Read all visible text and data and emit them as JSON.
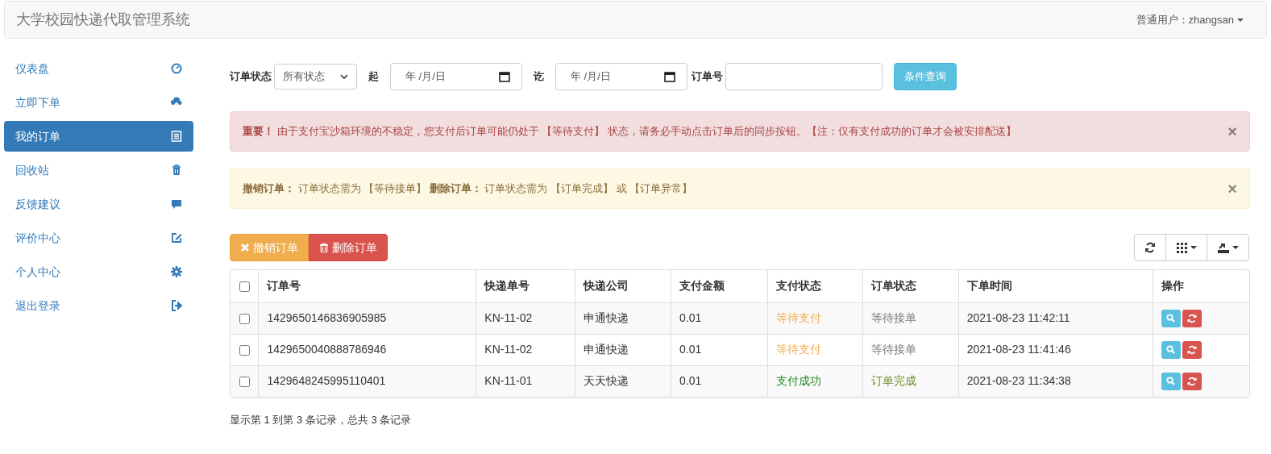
{
  "navbar": {
    "title": "大学校园快递代取管理系统",
    "user_menu": "普通用户：zhangsan"
  },
  "sidebar": {
    "items": [
      {
        "label": "仪表盘",
        "kind": "dashboard",
        "selected": false
      },
      {
        "label": "立即下单",
        "kind": "upload",
        "selected": false
      },
      {
        "label": "我的订单",
        "kind": "orders",
        "selected": true
      },
      {
        "label": "回收站",
        "kind": "trash",
        "selected": false
      },
      {
        "label": "反馈建议",
        "kind": "feedback",
        "selected": false
      },
      {
        "label": "评价中心",
        "kind": "review",
        "selected": false
      },
      {
        "label": "个人中心",
        "kind": "profile",
        "selected": false
      },
      {
        "label": "退出登录",
        "kind": "logout",
        "selected": false
      }
    ]
  },
  "filters": {
    "status_label": "订单状态",
    "status_value": "所有状态",
    "from_label": "起",
    "from_date": {
      "placeholder": "年 /月/日"
    },
    "to_label": "讫",
    "to_date": {
      "placeholder": "年 /月/日"
    },
    "order_no_label": "订单号",
    "search_button": "条件查询"
  },
  "alerts": [
    {
      "kind": "danger",
      "text": "**重要！** 由于支付宝沙箱环境的不稳定，您支付后订单可能仍处于 【等待支付】 状态，请务必手动点击订单后的同步按钮。【注：仅有支付成功的订单才会被安排配送】",
      "close": "×"
    },
    {
      "kind": "warning",
      "text": "**撤销订单：** 订单状态需为 【等待接单】 **删除订单：** 订单状态需为 【订单完成】 或 【订单异常】",
      "close": "×"
    }
  ],
  "toolbar": {
    "buttons": [
      {
        "label": "撤销订单",
        "kind": "cancel"
      },
      {
        "label": "删除订单",
        "kind": "delete"
      }
    ]
  },
  "table": {
    "columns": [
      "订单号",
      "快递单号",
      "快递公司",
      "支付金额",
      "支付状态",
      "订单状态",
      "下单时间",
      "操作"
    ],
    "rows": [
      {
        "checked": false,
        "order_no": "1429650146836905985",
        "tracking_no": "KN-11-02",
        "company": "申通快递",
        "amount": "0.01",
        "pay_status": {
          "text": "等待支付",
          "color": "#f0ad4e"
        },
        "order_status": {
          "text": "等待接单",
          "color": "#777777"
        },
        "time": "2021-08-23 11:42:11"
      },
      {
        "checked": false,
        "order_no": "1429650040888786946",
        "tracking_no": "KN-11-02",
        "company": "申通快递",
        "amount": "0.01",
        "pay_status": {
          "text": "等待支付",
          "color": "#f0ad4e"
        },
        "order_status": {
          "text": "等待接单",
          "color": "#777777"
        },
        "time": "2021-08-23 11:41:46"
      },
      {
        "checked": false,
        "order_no": "1429648245995110401",
        "tracking_no": "KN-11-01",
        "company": "天天快递",
        "amount": "0.01",
        "pay_status": {
          "text": "支付成功",
          "color": "#228b22"
        },
        "order_status": {
          "text": "订单完成",
          "color": "#6b8e23"
        },
        "time": "2021-08-23 11:34:38"
      }
    ],
    "header_checked": false
  },
  "pagination_info": "显示第 1 到第 3 条记录，总共 3 条记录"
}
